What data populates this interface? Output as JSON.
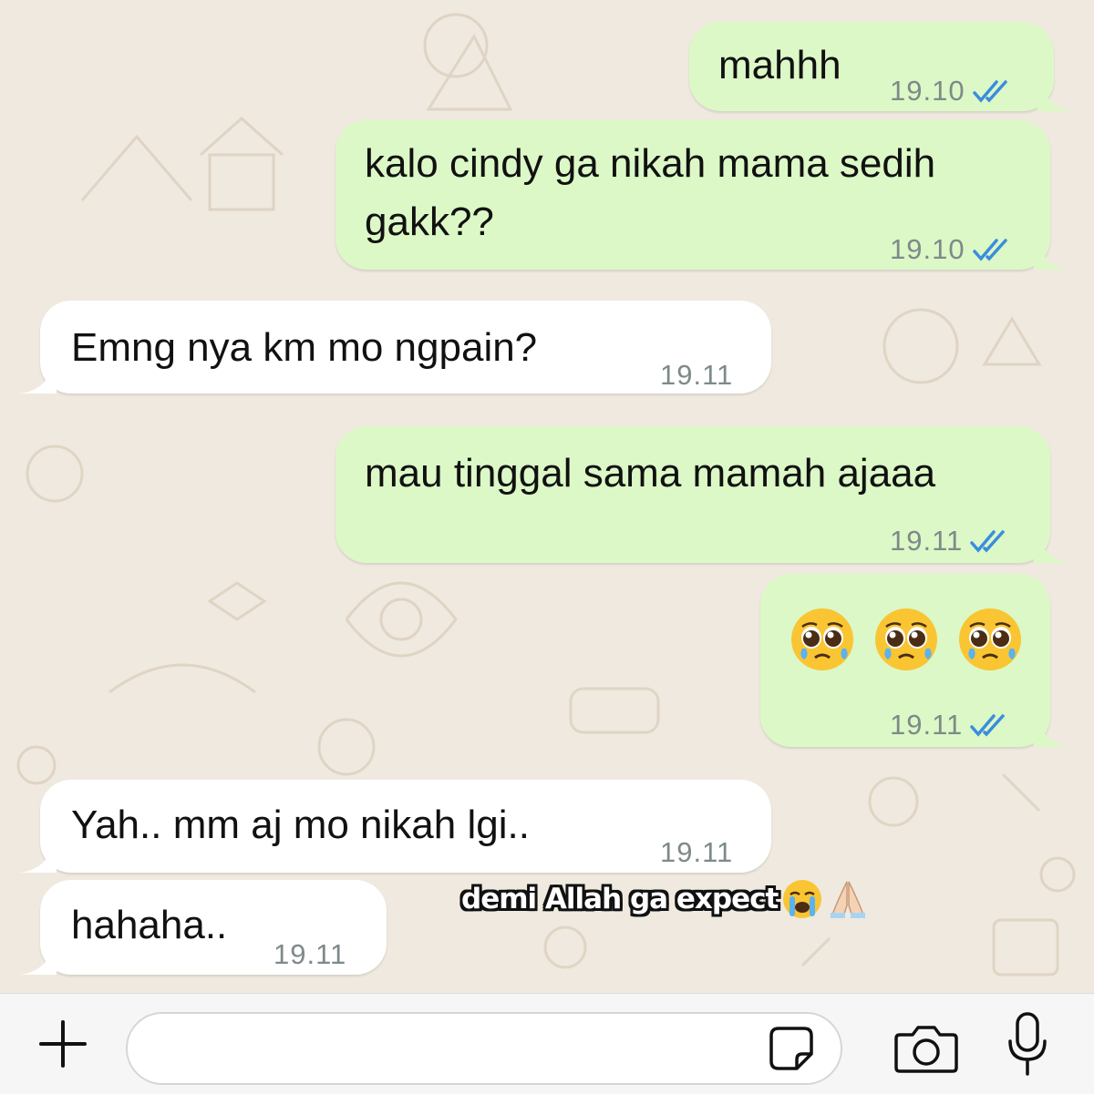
{
  "messages": [
    {
      "text": "mahhh",
      "time": "19.10",
      "direction": "outgoing",
      "read": true
    },
    {
      "text": "kalo cindy ga nikah mama sedih\ngakk??",
      "time": "19.10",
      "direction": "outgoing",
      "read": true
    },
    {
      "text": "Emng nya km mo ngpain?",
      "time": "19.11",
      "direction": "incoming"
    },
    {
      "text": "mau tinggal sama mamah ajaaa",
      "time": "19.11",
      "direction": "outgoing",
      "read": true
    },
    {
      "emoji": [
        "pleading-face",
        "pleading-face",
        "pleading-face"
      ],
      "time": "19.11",
      "direction": "outgoing",
      "read": true
    },
    {
      "text": "Yah.. mm aj mo nikah lgi..",
      "time": "19.11",
      "direction": "incoming"
    },
    {
      "text": "hahaha..",
      "time": "19.11",
      "direction": "incoming"
    }
  ],
  "overlay": {
    "caption": "demi Allah ga expect",
    "emoji": [
      "loudly-crying-face",
      "folded-hands"
    ]
  },
  "input_bar": {
    "attach_icon": "plus-icon",
    "message_value": "",
    "sticker_icon": "sticker-icon",
    "camera_icon": "camera-icon",
    "mic_icon": "microphone-icon"
  },
  "colors": {
    "outgoing_bubble": "#dcf8c6",
    "incoming_bubble": "#ffffff",
    "read_ticks": "#3a8dde",
    "wallpaper": "#efe9df",
    "timestamp": "#7e8a8a"
  }
}
